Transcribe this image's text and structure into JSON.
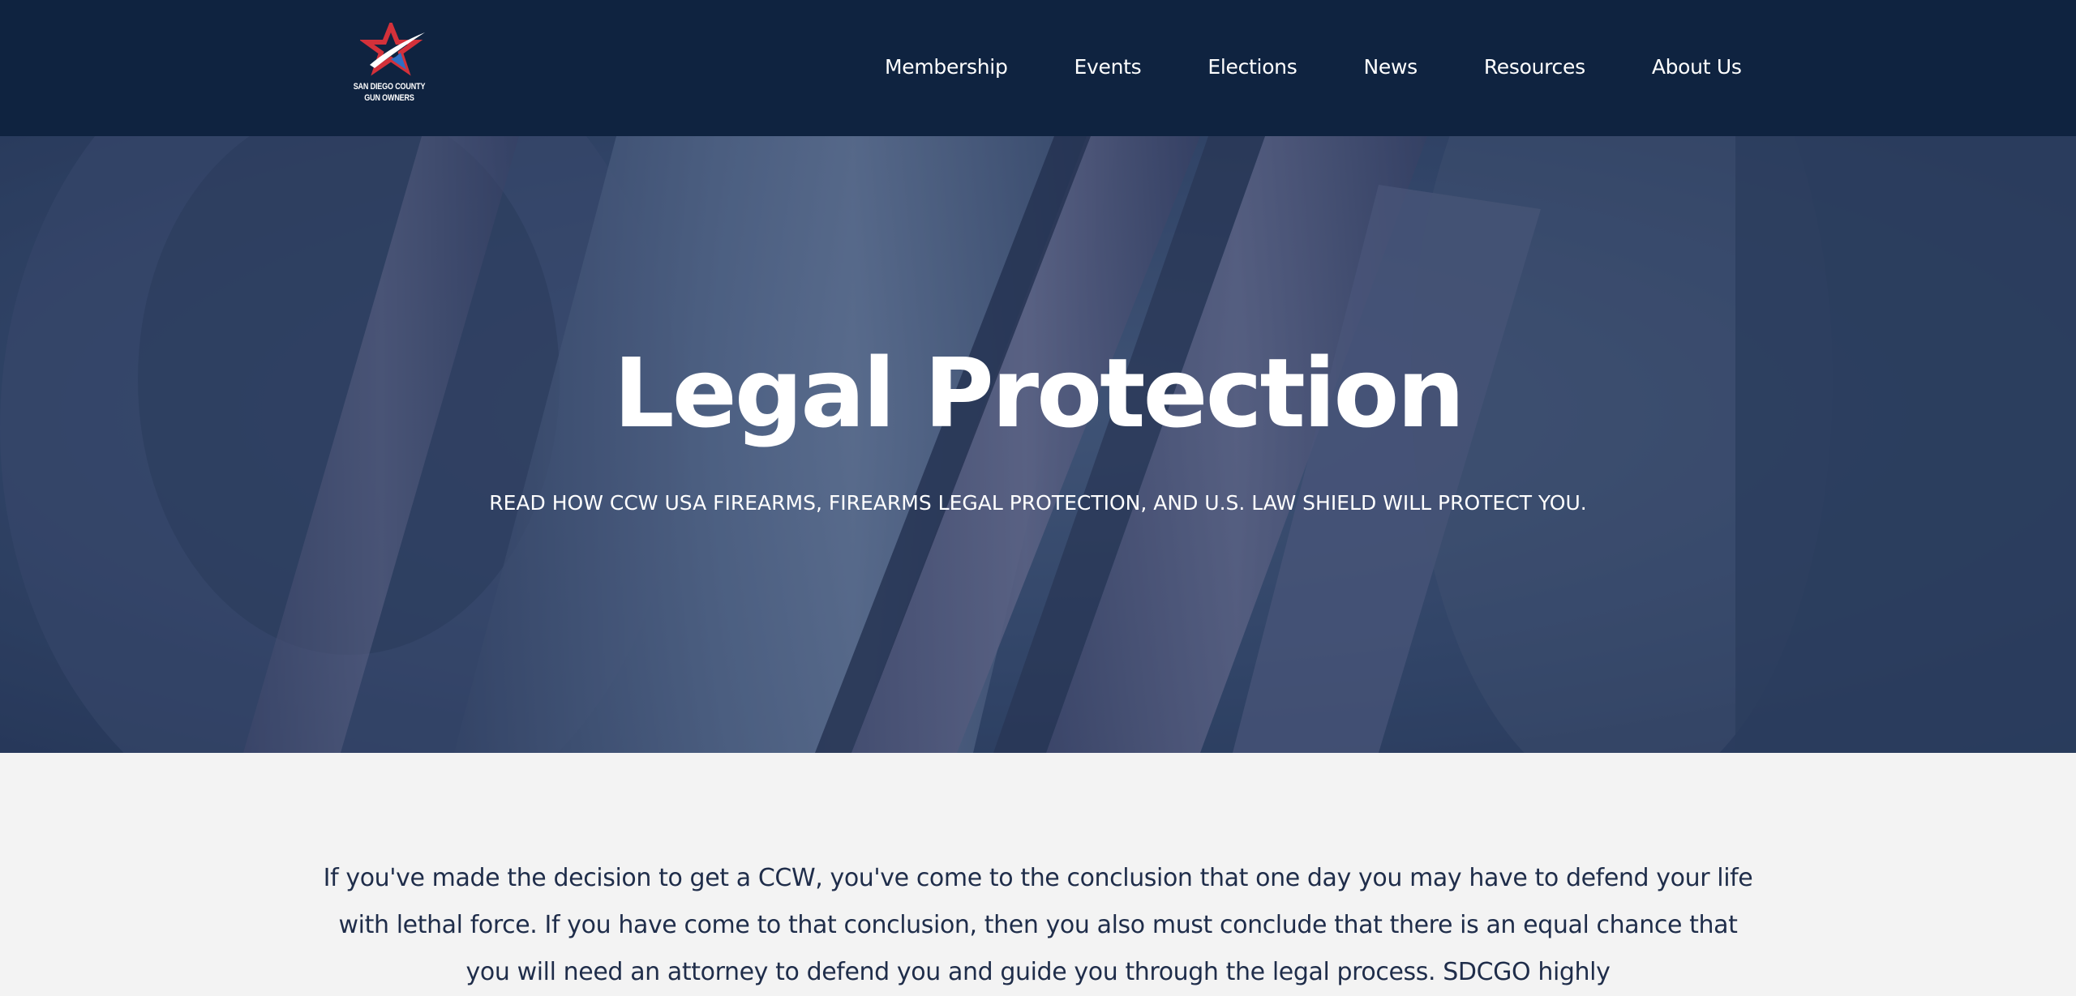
{
  "header": {
    "logo": {
      "line1": "SAN DIEGO COUNTY",
      "line2": "GUN OWNERS",
      "icon": "star-swoosh-logo"
    },
    "nav": [
      {
        "label": "Membership"
      },
      {
        "label": "Events"
      },
      {
        "label": "Elections"
      },
      {
        "label": "News"
      },
      {
        "label": "Resources"
      },
      {
        "label": "About Us"
      }
    ]
  },
  "hero": {
    "title": "Legal Protection",
    "subtitle": "READ HOW CCW USA FIREARMS, FIREARMS LEGAL PROTECTION, AND U.S. LAW SHIELD WILL PROTECT YOU."
  },
  "content": {
    "intro": "If you've made the decision to get a CCW, you've come to the conclusion that one day you may have to defend your life with lethal force.  If you have come to that conclusion, then you also must conclude that there is an equal chance that you will need an attorney to defend you and guide you through the legal process.  SDCGO highly"
  },
  "colors": {
    "header_bg": "#0f2340",
    "hero_overlay": "#2d3f5e",
    "page_bg": "#f3f3f3",
    "body_text": "#1f2d4a",
    "logo_red": "#d3313a",
    "logo_blue": "#2f6fc4"
  }
}
